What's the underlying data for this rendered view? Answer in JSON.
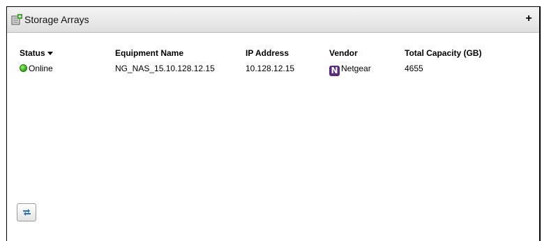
{
  "panel": {
    "title": "Storage Arrays",
    "add_icon": "plus-icon",
    "header_icon": "storage-array-add-icon"
  },
  "table": {
    "columns": [
      "Status",
      "Equipment Name",
      "IP Address",
      "Vendor",
      "Total Capacity (GB)"
    ],
    "sort_indicator": "descending",
    "rows": [
      {
        "status": "Online",
        "status_icon": "online-status-icon",
        "status_color": "#2ca412",
        "equipment_name": "NG_NAS_15.10.128.12.15",
        "ip_address": "10.128.12.15",
        "vendor": "Netgear",
        "vendor_logo_letter": "N",
        "vendor_logo_color": "#5a2a82",
        "total_capacity_gb": "4655"
      }
    ]
  },
  "footer": {
    "refresh_icon": "refresh-arrows-icon"
  },
  "plus_symbol": "+"
}
